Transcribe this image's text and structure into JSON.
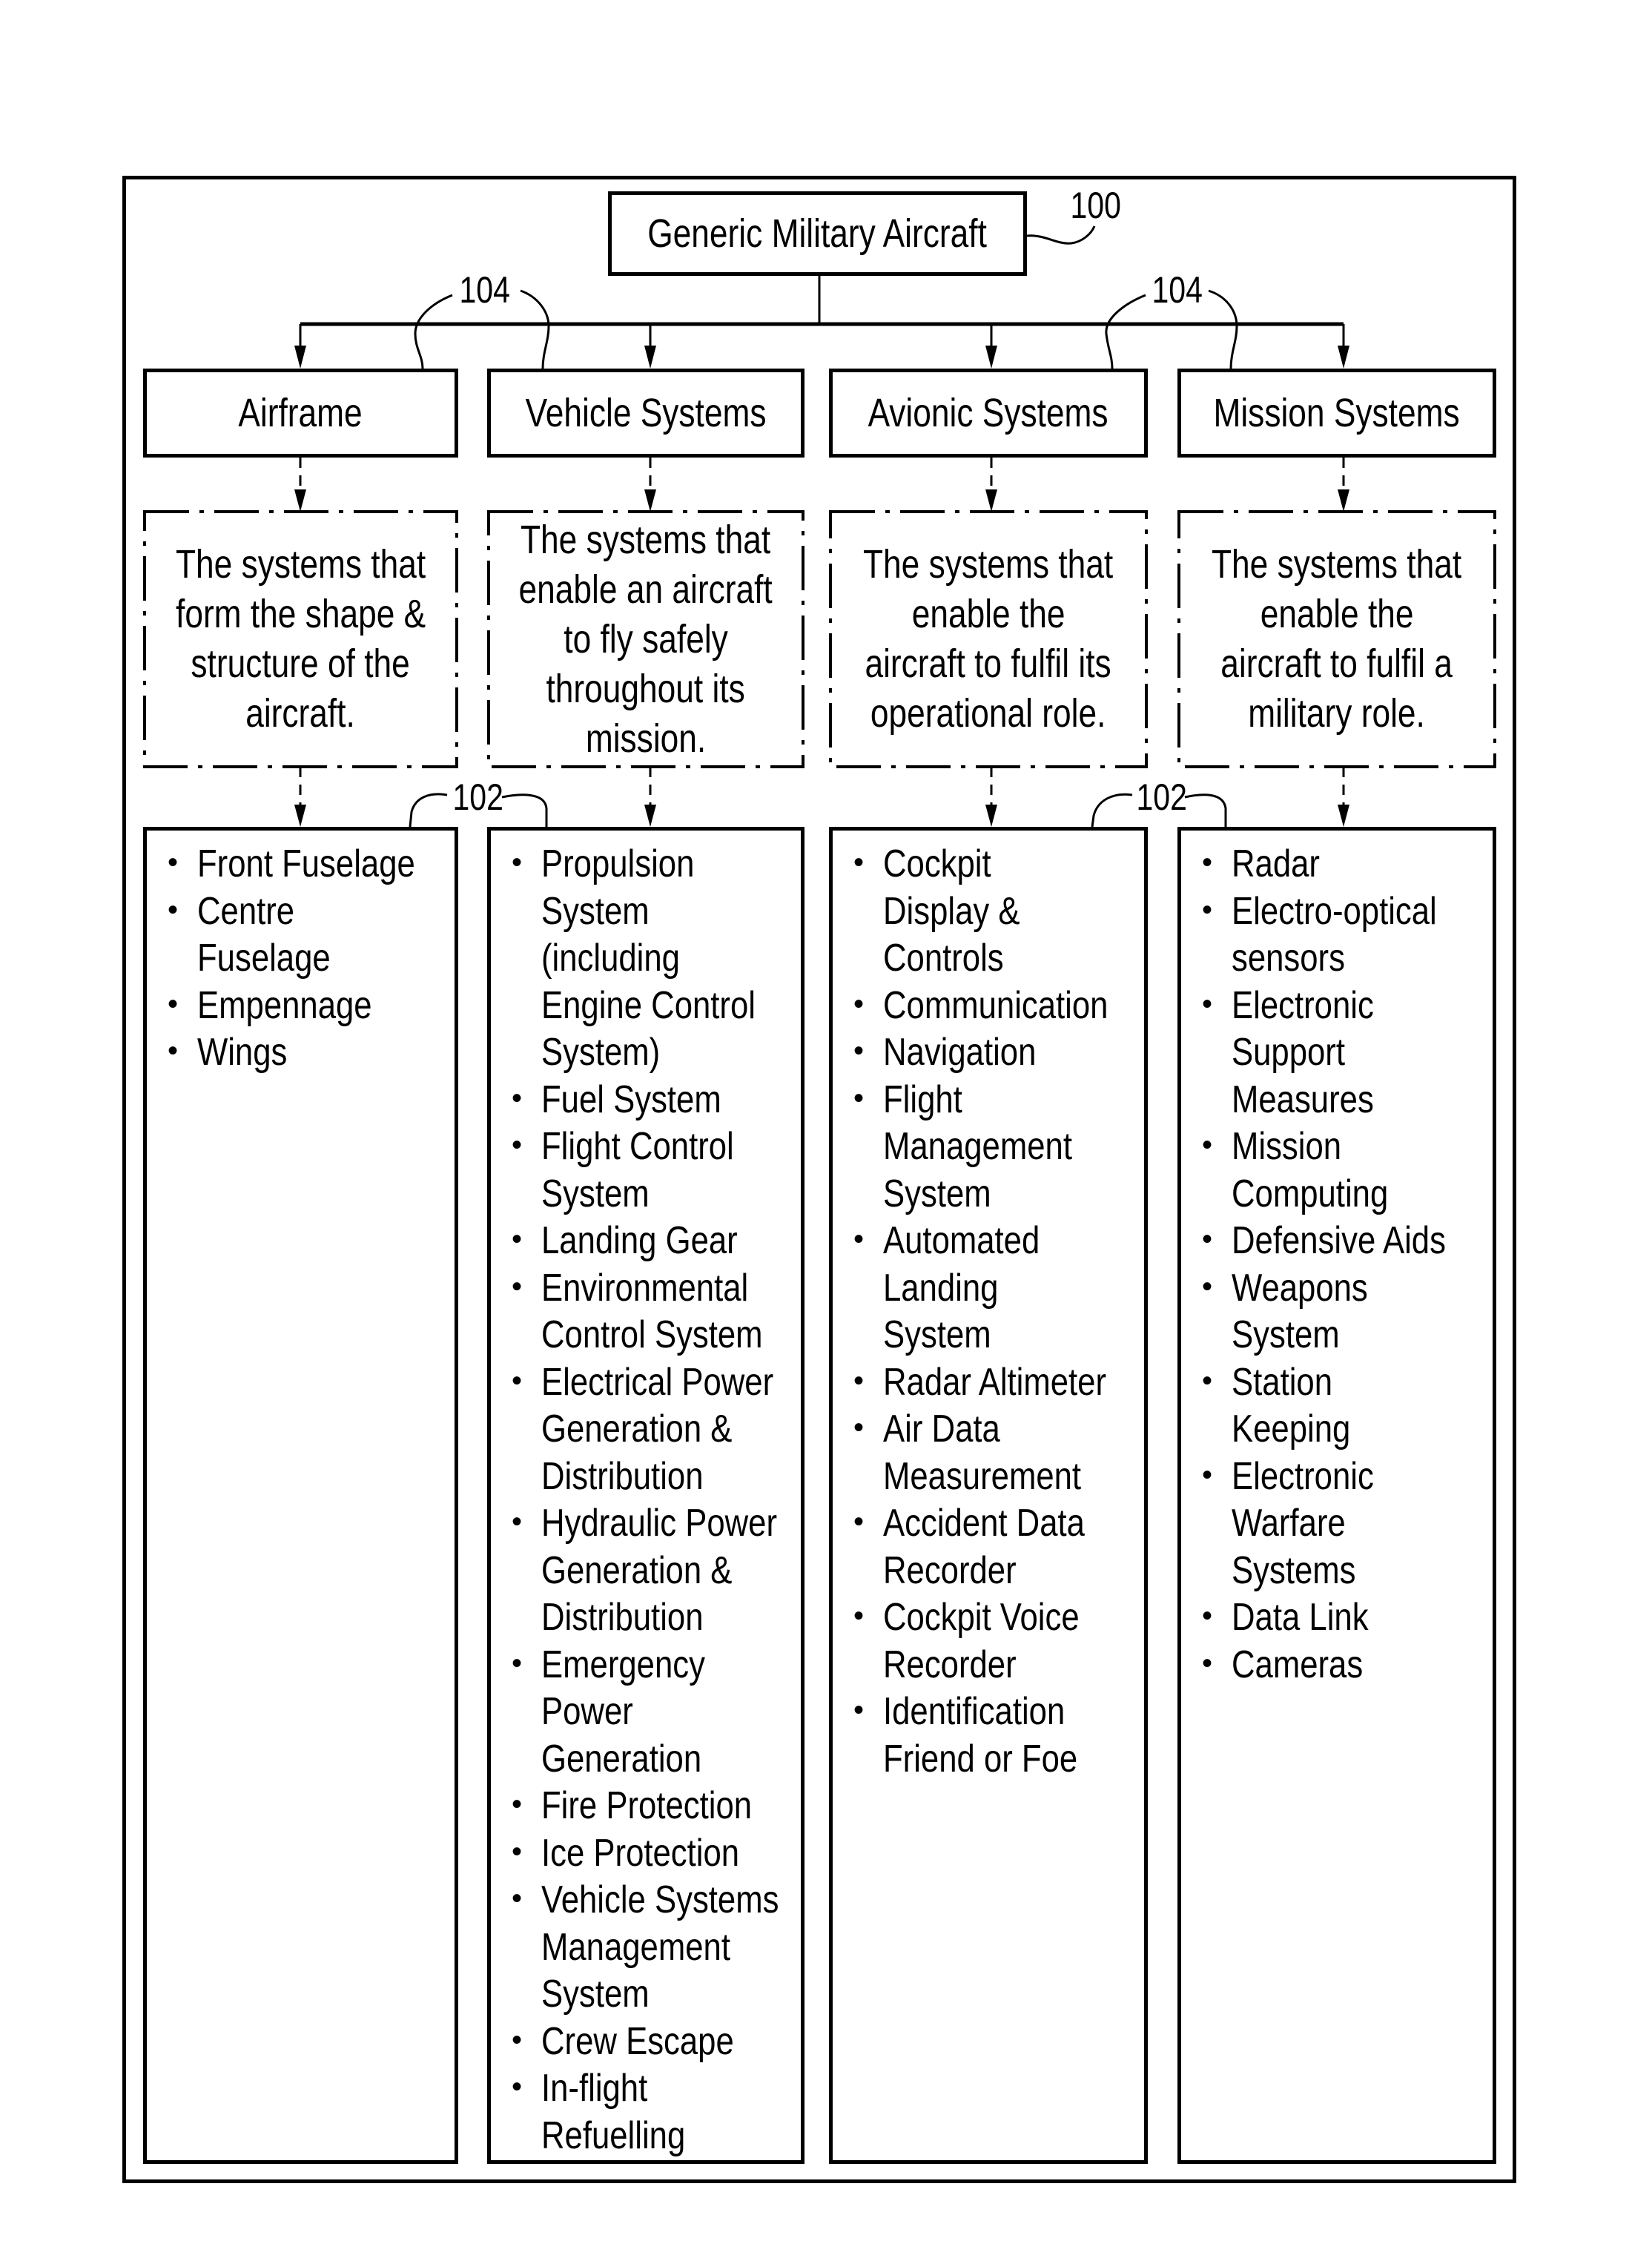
{
  "root": {
    "label": "Generic Military Aircraft",
    "ref": "100"
  },
  "refs": {
    "categories": "104",
    "lists": "102"
  },
  "columns": [
    {
      "title": "Airframe",
      "description": [
        "The systems that",
        "form the shape &",
        "structure of the",
        "aircraft."
      ],
      "items": [
        [
          "Front Fuselage"
        ],
        [
          "Centre",
          "Fuselage"
        ],
        [
          "Empennage"
        ],
        [
          "Wings"
        ]
      ]
    },
    {
      "title": "Vehicle Systems",
      "description": [
        "The systems that",
        "enable an aircraft",
        "to fly safely",
        "throughout its",
        "mission."
      ],
      "items": [
        [
          "Propulsion",
          "System",
          "(including",
          "Engine Control",
          "System)"
        ],
        [
          "Fuel System"
        ],
        [
          "Flight Control",
          "System"
        ],
        [
          "Landing Gear"
        ],
        [
          "Environmental",
          "Control System"
        ],
        [
          "Electrical Power",
          "Generation &",
          "Distribution"
        ],
        [
          "Hydraulic Power",
          "Generation &",
          "Distribution"
        ],
        [
          "Emergency",
          "Power",
          "Generation"
        ],
        [
          "Fire Protection"
        ],
        [
          "Ice Protection"
        ],
        [
          "Vehicle Systems",
          "Management",
          "System"
        ],
        [
          "Crew Escape"
        ],
        [
          "In-flight",
          "Refuelling"
        ]
      ]
    },
    {
      "title": "Avionic Systems",
      "description": [
        "The systems that",
        "enable the",
        "aircraft to fulfil its",
        "operational role."
      ],
      "items": [
        [
          "Cockpit",
          "Display &",
          "Controls"
        ],
        [
          "Communication"
        ],
        [
          "Navigation"
        ],
        [
          "Flight",
          "Management",
          "System"
        ],
        [
          "Automated",
          "Landing",
          "System"
        ],
        [
          "Radar Altimeter"
        ],
        [
          "Air Data",
          "Measurement"
        ],
        [
          "Accident Data",
          "Recorder"
        ],
        [
          "Cockpit Voice",
          "Recorder"
        ],
        [
          "Identification",
          "Friend or Foe"
        ]
      ]
    },
    {
      "title": "Mission Systems",
      "description": [
        "The systems that",
        "enable the",
        "aircraft to fulfil a",
        "military role."
      ],
      "items": [
        [
          "Radar"
        ],
        [
          "Electro-optical",
          "sensors"
        ],
        [
          "Electronic",
          "Support",
          "Measures"
        ],
        [
          "Mission",
          "Computing"
        ],
        [
          "Defensive Aids"
        ],
        [
          "Weapons",
          "System"
        ],
        [
          "Station",
          "Keeping"
        ],
        [
          "Electronic",
          "Warfare",
          "Systems"
        ],
        [
          "Data Link"
        ],
        [
          "Cameras"
        ]
      ]
    }
  ],
  "bullet_glyph": "•"
}
